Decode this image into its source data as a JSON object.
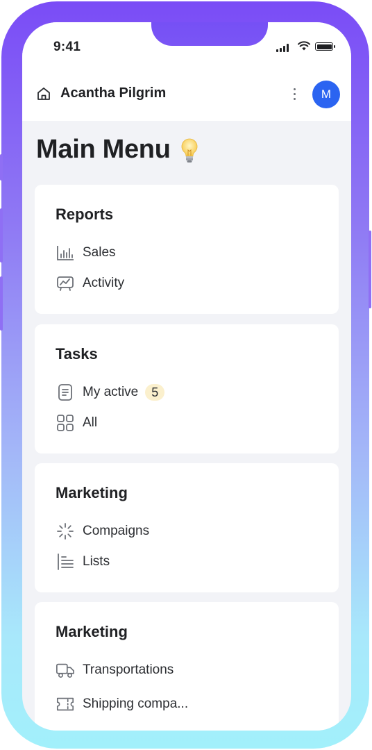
{
  "status_bar": {
    "time": "9:41"
  },
  "header": {
    "app_title": "Acantha Pilgrim",
    "avatar_initial": "M"
  },
  "page": {
    "title": "Main Menu"
  },
  "sections": [
    {
      "title": "Reports",
      "items": [
        {
          "label": "Sales",
          "icon": "bar-chart-icon"
        },
        {
          "label": "Activity",
          "icon": "activity-chart-icon"
        }
      ]
    },
    {
      "title": "Tasks",
      "items": [
        {
          "label": "My active",
          "icon": "document-icon",
          "badge": "5"
        },
        {
          "label": "All",
          "icon": "grid-icon"
        }
      ]
    },
    {
      "title": "Marketing",
      "items": [
        {
          "label": "Compaigns",
          "icon": "loader-icon"
        },
        {
          "label": "Lists",
          "icon": "list-icon"
        }
      ]
    },
    {
      "title": "Marketing",
      "items": [
        {
          "label": "Transportations",
          "icon": "truck-icon"
        },
        {
          "label": "Shipping compa...",
          "icon": "ticket-icon"
        }
      ]
    }
  ],
  "colors": {
    "avatar": "#2b64f1",
    "badge_bg": "#fbf0cd",
    "frame_top": "#7a4cf6",
    "frame_bottom": "#a2f0fb",
    "background": "#f2f3f7"
  }
}
